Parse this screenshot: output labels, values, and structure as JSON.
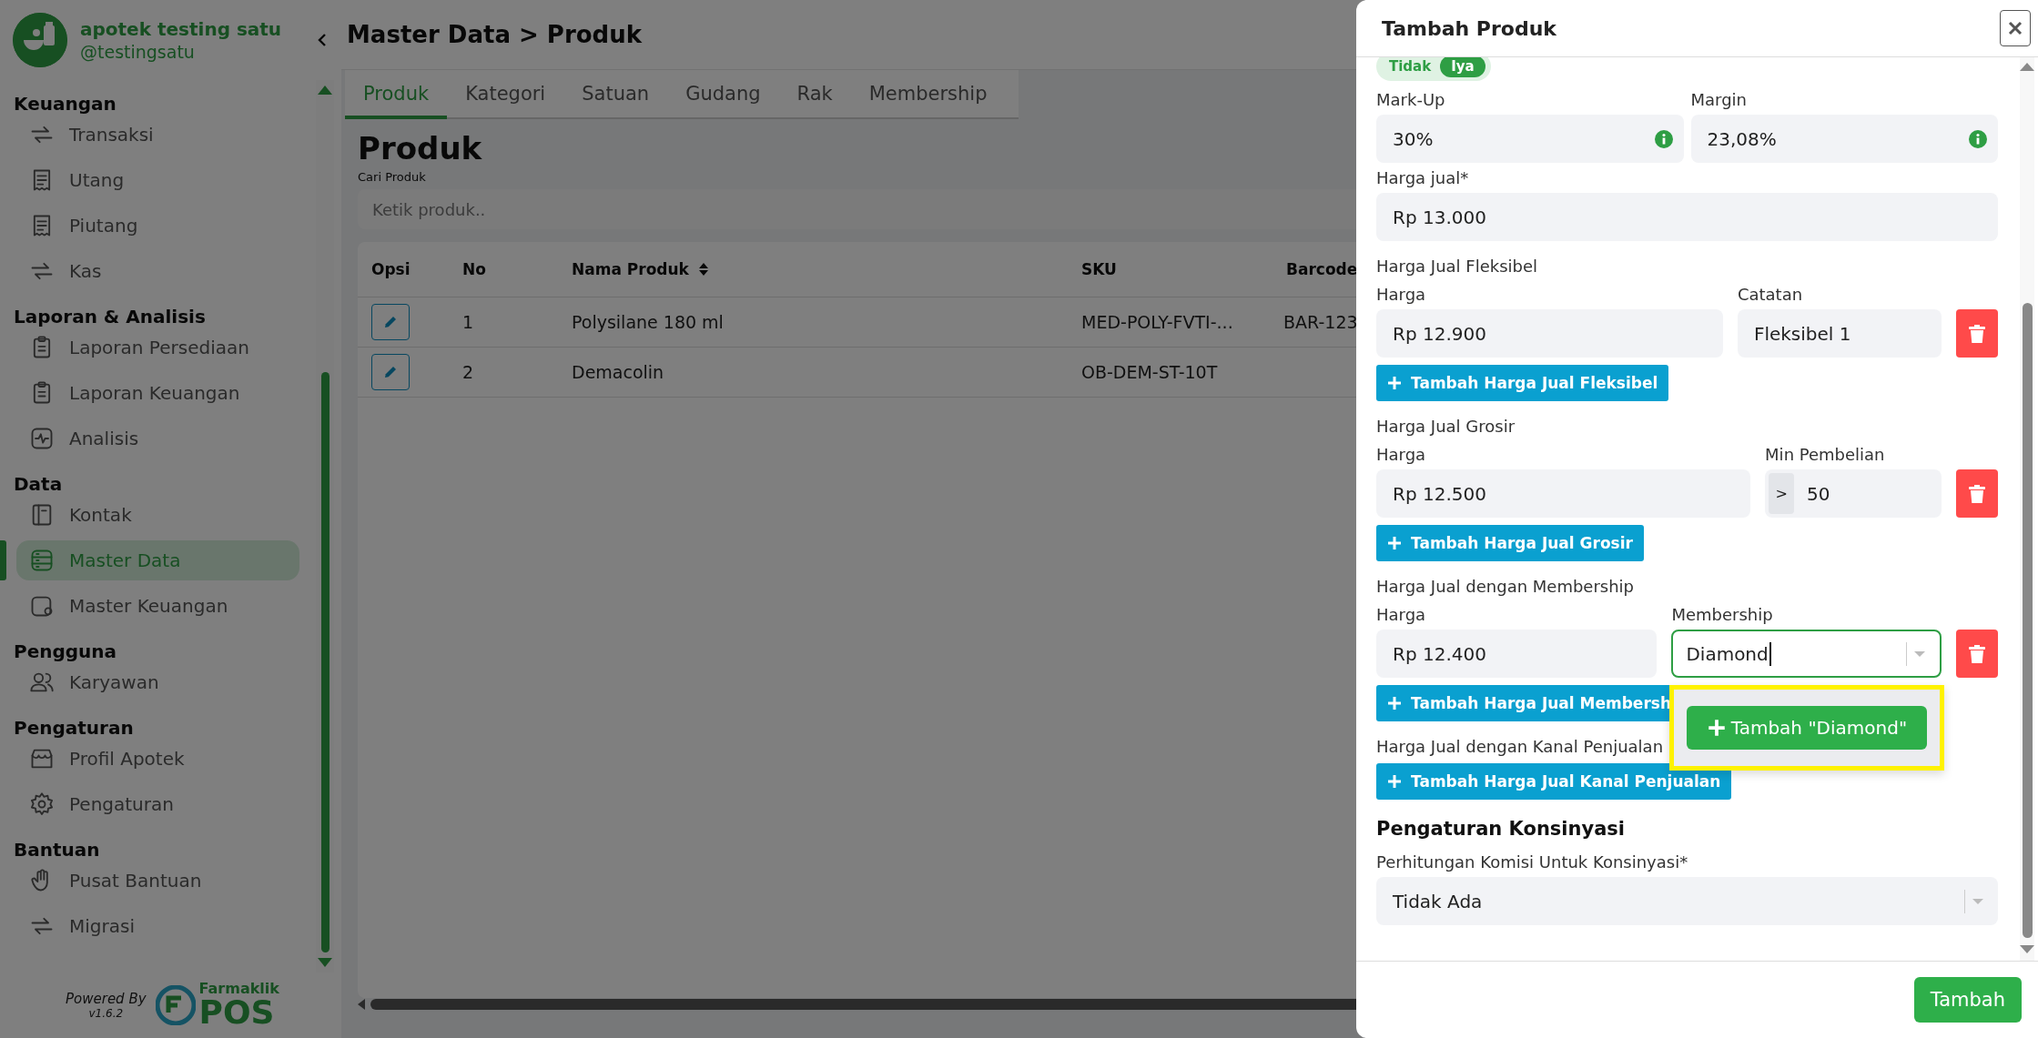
{
  "sidebar": {
    "store_name": "apotek testing satu",
    "handle": "@testingsatu",
    "sections": [
      {
        "title": "Keuangan",
        "items": [
          {
            "label": "Transaksi",
            "selected": false
          },
          {
            "label": "Utang",
            "selected": false
          },
          {
            "label": "Piutang",
            "selected": false
          },
          {
            "label": "Kas",
            "selected": false
          }
        ]
      },
      {
        "title": "Laporan & Analisis",
        "items": [
          {
            "label": "Laporan Persediaan",
            "selected": false
          },
          {
            "label": "Laporan Keuangan",
            "selected": false
          },
          {
            "label": "Analisis",
            "selected": false
          }
        ]
      },
      {
        "title": "Data",
        "items": [
          {
            "label": "Kontak",
            "selected": false
          },
          {
            "label": "Master Data",
            "selected": true
          },
          {
            "label": "Master Keuangan",
            "selected": false
          }
        ]
      },
      {
        "title": "Pengguna",
        "items": [
          {
            "label": "Karyawan",
            "selected": false
          }
        ]
      },
      {
        "title": "Pengaturan",
        "items": [
          {
            "label": "Profil Apotek",
            "selected": false
          },
          {
            "label": "Pengaturan",
            "selected": false
          }
        ]
      },
      {
        "title": "Bantuan",
        "items": [
          {
            "label": "Pusat Bantuan",
            "selected": false
          },
          {
            "label": "Migrasi",
            "selected": false
          }
        ]
      }
    ],
    "powered_by": "Powered By",
    "version": "v1.6.2",
    "brand_top": "Farmaklik",
    "brand_bottom": "POS"
  },
  "header": {
    "breadcrumb": "Master Data > Produk"
  },
  "tabs": [
    {
      "label": "Produk",
      "selected": true
    },
    {
      "label": "Kategori",
      "selected": false
    },
    {
      "label": "Satuan",
      "selected": false
    },
    {
      "label": "Gudang",
      "selected": false
    },
    {
      "label": "Rak",
      "selected": false
    },
    {
      "label": "Membership",
      "selected": false
    }
  ],
  "page_title": "Produk",
  "search": {
    "label": "Cari Produk",
    "placeholder": "Ketik produk.."
  },
  "table": {
    "columns": [
      {
        "label": "Opsi"
      },
      {
        "label": "No"
      },
      {
        "label": "Nama Produk",
        "sortable": true
      },
      {
        "label": "SKU"
      },
      {
        "label": "Barcode"
      }
    ],
    "rows": [
      [
        "",
        "1",
        "Polysilane 180 ml",
        "MED-POLY-FVTI-...",
        "BAR-123"
      ],
      [
        "",
        "2",
        "Demacolin",
        "OB-DEM-ST-10T",
        ""
      ]
    ]
  },
  "drawer": {
    "title": "Tambah Produk",
    "toggle": [
      {
        "label": "Tidak",
        "selected": false
      },
      {
        "label": "Iya",
        "selected": true
      }
    ],
    "markup": {
      "label": "Mark-Up",
      "value": "30%"
    },
    "margin": {
      "label": "Margin",
      "value": "23,08%"
    },
    "selling_price": {
      "label": "Harga jual*",
      "value": "Rp 13.000"
    },
    "groups": [
      {
        "title": "Harga Jual Fleksibel",
        "fields": [
          {
            "kind": "text",
            "label": "Harga",
            "value": "Rp 12.900"
          },
          {
            "kind": "text",
            "label": "Catatan",
            "value": "Fleksibel 1"
          }
        ],
        "add_button": "Tambah Harga Jual Fleksibel"
      },
      {
        "title": "Harga Jual Grosir",
        "fields": [
          {
            "kind": "text",
            "label": "Harga",
            "value": "Rp 12.500"
          },
          {
            "kind": "prefixed",
            "label": "Min Pembelian",
            "prefix": ">",
            "value": "50"
          }
        ],
        "add_button": "Tambah Harga Jual Grosir"
      },
      {
        "title": "Harga Jual dengan Membership",
        "fields": [
          {
            "kind": "text",
            "label": "Harga",
            "value": "Rp 12.400"
          },
          {
            "kind": "select",
            "label": "Membership",
            "value": "Diamond",
            "focused": true,
            "menu_option": "Tambah \"Diamond\""
          }
        ],
        "add_button": "Tambah Harga Jual Membersh"
      },
      {
        "title": "Harga Jual dengan Kanal Penjualan",
        "add_button": "Tambah Harga Jual Kanal Penjualan"
      }
    ],
    "consignment": {
      "heading": "Pengaturan Konsinyasi",
      "label": "Perhitungan Komisi Untuk Konsinyasi*",
      "value": "Tidak Ada"
    },
    "submit": "Tambah"
  }
}
